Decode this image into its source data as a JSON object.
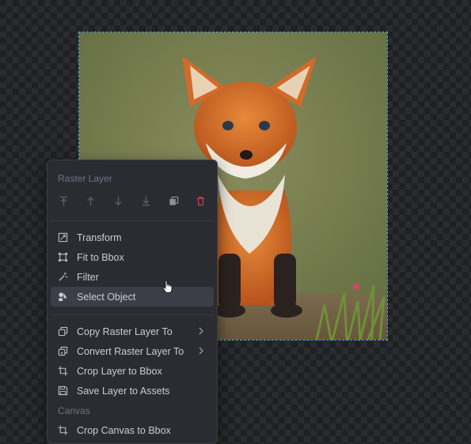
{
  "menu": {
    "section_raster": "Raster Layer",
    "toolbar_icons": [
      "move-to-top-icon",
      "move-up-icon",
      "move-down-icon",
      "move-to-bottom-icon",
      "duplicate-icon",
      "delete-icon"
    ],
    "items": [
      {
        "label": "Transform",
        "icon": "transform-icon"
      },
      {
        "label": "Fit to Bbox",
        "icon": "fit-bbox-icon"
      },
      {
        "label": "Filter",
        "icon": "filter-wand-icon"
      },
      {
        "label": "Select Object",
        "icon": "select-object-icon",
        "highlighted": true
      }
    ],
    "items2": [
      {
        "label": "Copy Raster Layer To",
        "icon": "copy-layer-icon",
        "submenu": true
      },
      {
        "label": "Convert Raster Layer To",
        "icon": "convert-layer-icon",
        "submenu": true
      },
      {
        "label": "Crop Layer to Bbox",
        "icon": "crop-icon"
      },
      {
        "label": "Save Layer to Assets",
        "icon": "save-icon"
      }
    ],
    "section_canvas": "Canvas",
    "items3": [
      {
        "label": "Crop Canvas to Bbox",
        "icon": "crop-icon"
      }
    ]
  },
  "colors": {
    "menu_bg": "#2a2c31",
    "highlight": "#3b3e46",
    "bbox_outline": "#4fa8d8",
    "delete_icon": "#c0454a"
  }
}
